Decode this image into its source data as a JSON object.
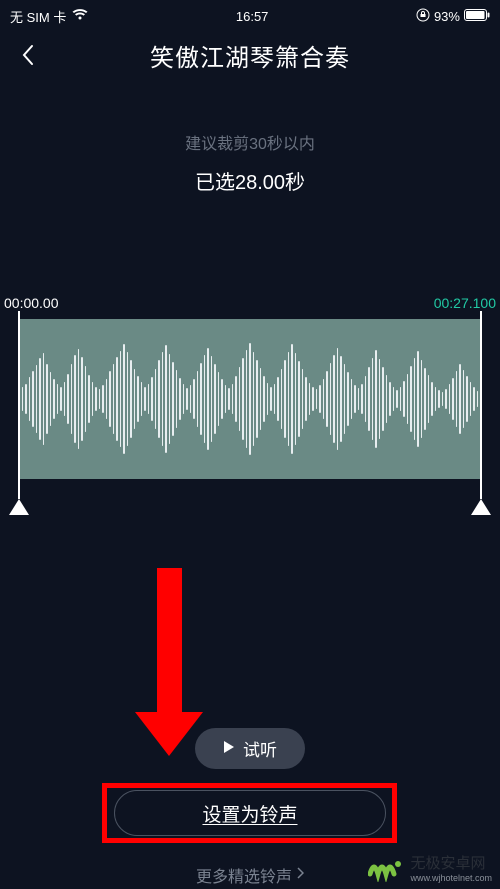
{
  "status": {
    "sim": "无 SIM 卡",
    "time": "16:57",
    "battery": "93%"
  },
  "header": {
    "title": "笑傲江湖琴箫合奏"
  },
  "trim": {
    "hint": "建议裁剪30秒以内",
    "selected": "已选28.00秒",
    "start": "00:00.00",
    "end": "00:27.100"
  },
  "buttons": {
    "preview": "试听",
    "set_ringtone": "设置为铃声",
    "more": "更多精选铃声"
  },
  "watermark": {
    "brand": "无极安卓网",
    "url": "www.wjhotelnet.com"
  }
}
